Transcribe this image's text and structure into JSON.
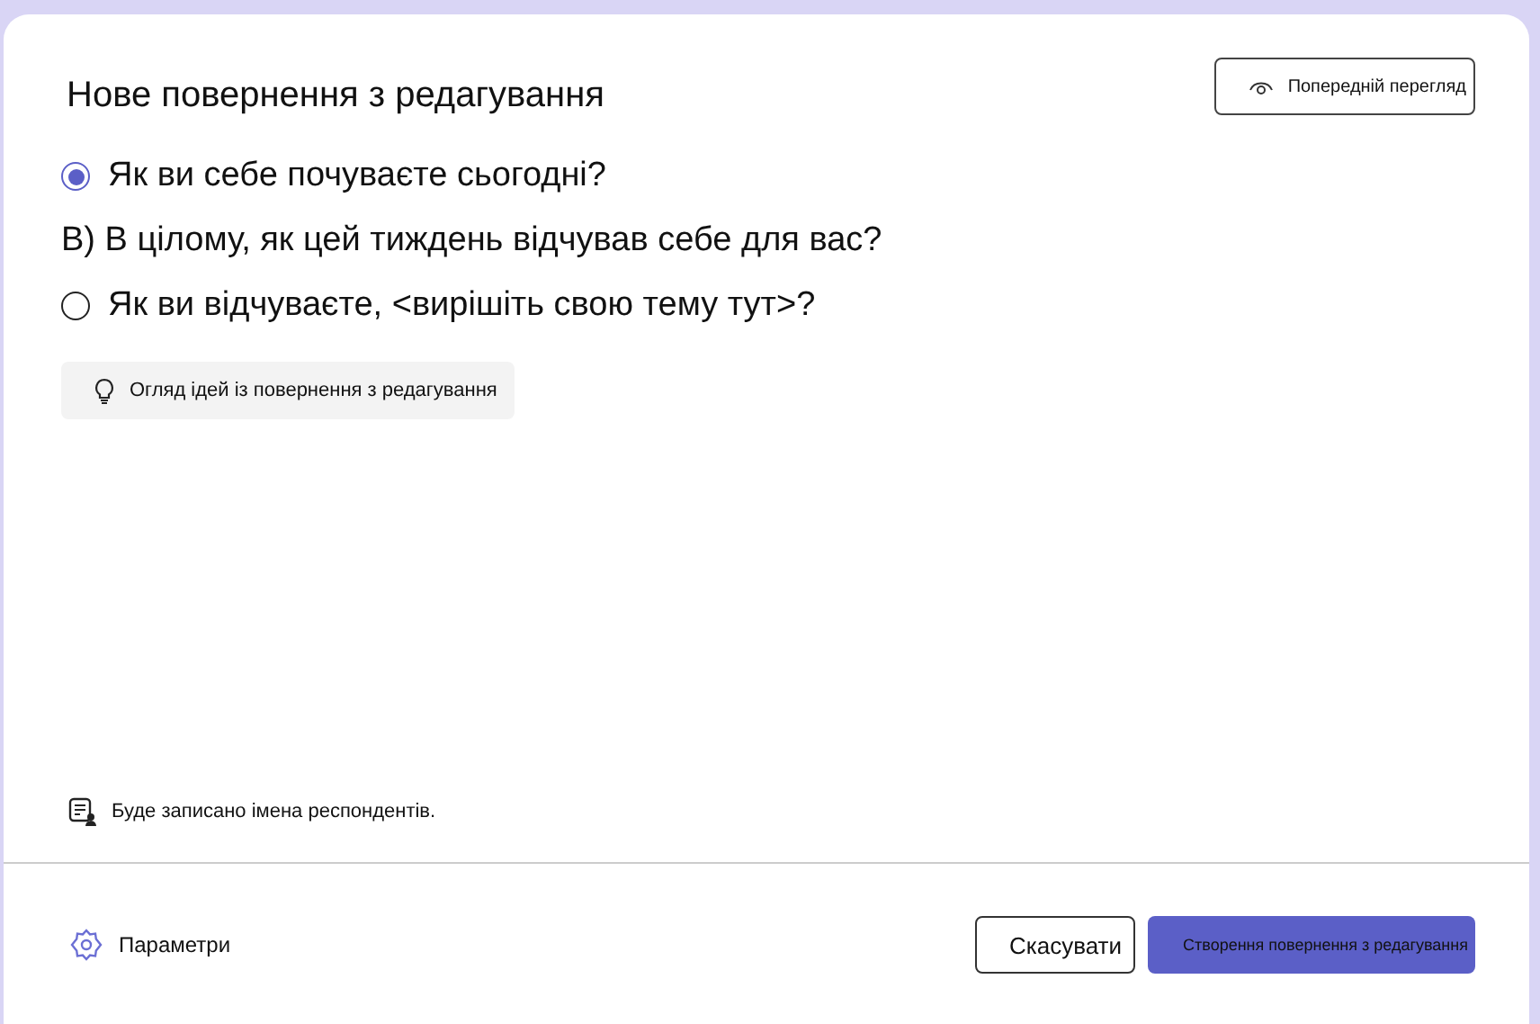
{
  "dialog": {
    "title": "Нове повернення з редагування",
    "preview_button": "Попередній перегляд"
  },
  "questions": [
    {
      "kind": "radio",
      "text": "Як ви себе почуваєте сьогодні?",
      "selected": true
    },
    {
      "kind": "plain",
      "text": "В) В цілому, як цей тиждень відчував себе для вас?"
    },
    {
      "kind": "radio",
      "text": "Як ви відчуваєте, <вирішіть свою тему тут>?",
      "selected": false
    }
  ],
  "ideas_button": "Огляд ідей із повернення з редагування",
  "note": "Буде записано імена респондентів.",
  "footer": {
    "settings": "Параметри",
    "cancel": "Скасувати",
    "create": "Створення повернення з редагування"
  }
}
